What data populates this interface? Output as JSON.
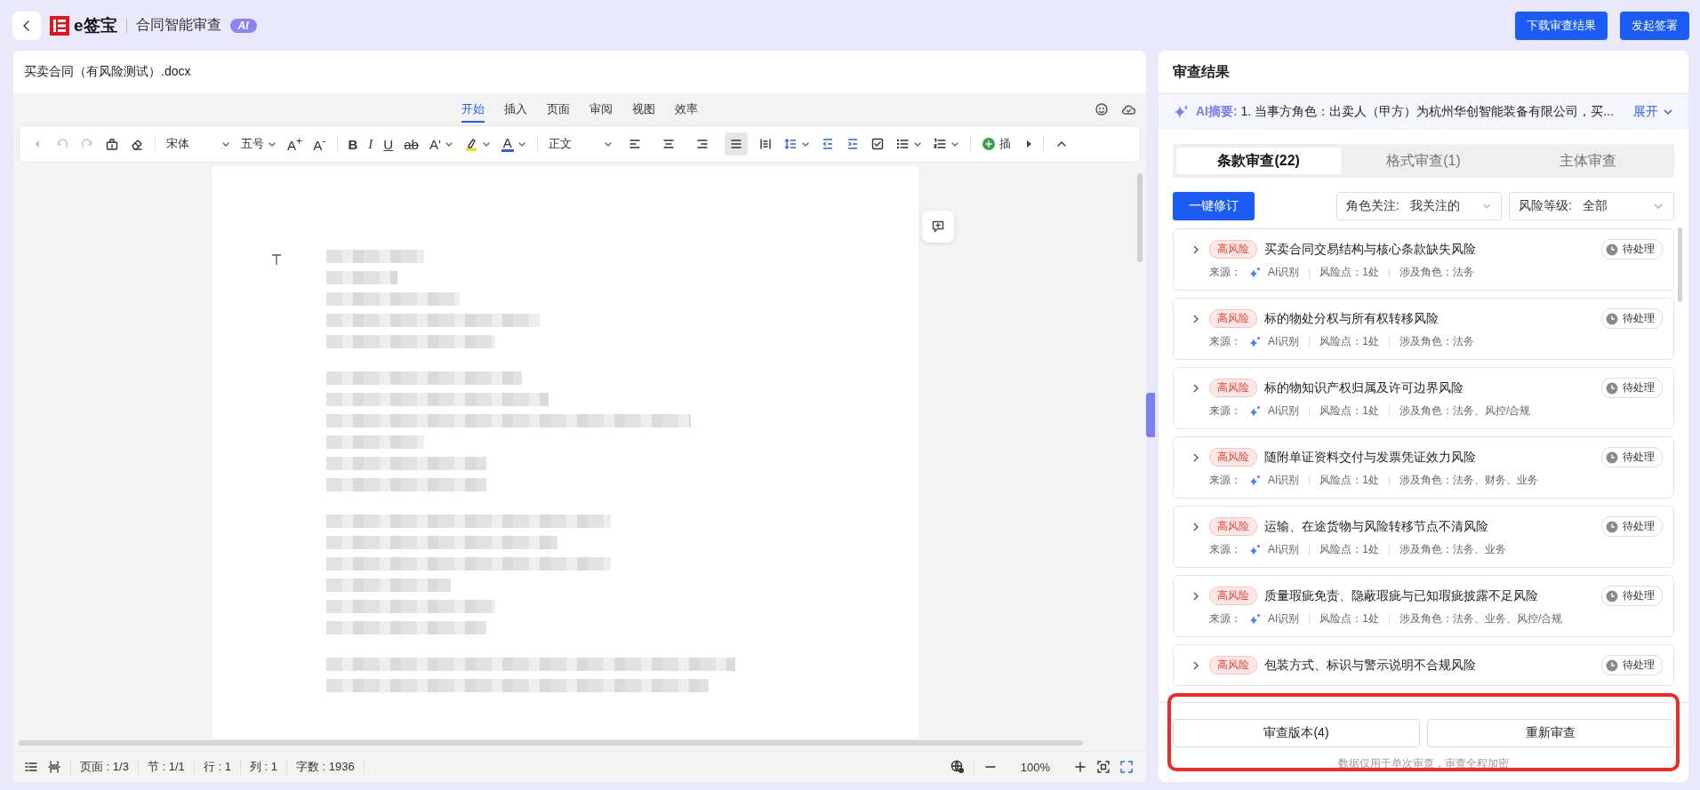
{
  "header": {
    "logo_text": "e签宝",
    "app_title": "合同智能审查",
    "ai_badge": "AI",
    "actions": [
      {
        "label": "下载审查结果"
      },
      {
        "label": "发起签署"
      }
    ]
  },
  "document": {
    "file_name": "买卖合同（有风险测试）.docx",
    "ribbon_tabs": [
      {
        "label": "开始",
        "selected": true
      },
      {
        "label": "插入",
        "selected": false
      },
      {
        "label": "页面",
        "selected": false
      },
      {
        "label": "审阅",
        "selected": false
      },
      {
        "label": "视图",
        "selected": false
      },
      {
        "label": "效率",
        "selected": false
      }
    ],
    "toolbar": {
      "font": "宋体",
      "font_size": "五号",
      "font_size_buttons": [
        "A$^{+}$",
        "A$^{-}$"
      ],
      "style_buttons": [
        "B",
        "I",
        "U",
        "ab"
      ],
      "text_effect": "A'",
      "font_color": "A",
      "paragraph_style": "正文",
      "alignment": [
        {
          "selected": false
        },
        {
          "selected": false
        },
        {
          "selected": false
        },
        {
          "selected": true
        }
      ],
      "insert_label": "插"
    },
    "status_bar": {
      "items": [
        "页面 : 1/3",
        "节 : 1/1",
        "行 : 1",
        "列 : 1",
        "字数 : 1936"
      ],
      "zoom": "100%"
    }
  },
  "review": {
    "title": "审查结果",
    "summary": {
      "label": "AI摘要:",
      "text": "1. 当事方角色：出卖人（甲方）为杭州华创智能装备有限公司，买...",
      "expand": "展开"
    },
    "tabs": [
      {
        "label": "条款审查(22)",
        "selected": true
      },
      {
        "label": "格式审查(1)",
        "selected": false
      },
      {
        "label": "主体审查",
        "selected": false
      }
    ],
    "fix_all": "一键修订",
    "filters": [
      {
        "label": "角色关注:",
        "value": "我关注的"
      },
      {
        "label": "风险等级:",
        "value": "全部"
      }
    ],
    "items": [
      {
        "risk": "高风险",
        "title": "买卖合同交易结构与核心条款缺失风险",
        "status": "待处理",
        "source_label": "来源：",
        "source": "AI识别",
        "points": "风险点：1处",
        "roles": "涉及角色：法务"
      },
      {
        "risk": "高风险",
        "title": "标的物处分权与所有权转移风险",
        "status": "待处理",
        "source_label": "来源：",
        "source": "AI识别",
        "points": "风险点：1处",
        "roles": "涉及角色：法务"
      },
      {
        "risk": "高风险",
        "title": "标的物知识产权归属及许可边界风险",
        "status": "待处理",
        "source_label": "来源：",
        "source": "AI识别",
        "points": "风险点：1处",
        "roles": "涉及角色：法务、风控/合规"
      },
      {
        "risk": "高风险",
        "title": "随附单证资料交付与发票凭证效力风险",
        "status": "待处理",
        "source_label": "来源：",
        "source": "AI识别",
        "points": "风险点：1处",
        "roles": "涉及角色：法务、财务、业务"
      },
      {
        "risk": "高风险",
        "title": "运输、在途货物与风险转移节点不清风险",
        "status": "待处理",
        "source_label": "来源：",
        "source": "AI识别",
        "points": "风险点：1处",
        "roles": "涉及角色：法务、业务"
      },
      {
        "risk": "高风险",
        "title": "质量瑕疵免责、隐蔽瑕疵与已知瑕疵披露不足风险",
        "status": "待处理",
        "source_label": "来源：",
        "source": "AI识别",
        "points": "风险点：1处",
        "roles": "涉及角色：法务、业务、风控/合规"
      },
      {
        "risk": "高风险",
        "title": "包装方式、标识与警示说明不合规风险",
        "status": "待处理"
      }
    ],
    "footer_buttons": [
      {
        "label": "审查版本(4)"
      },
      {
        "label": "重新审查"
      }
    ],
    "footer_note": "数据仅用于单次审查，审查全程加密"
  }
}
